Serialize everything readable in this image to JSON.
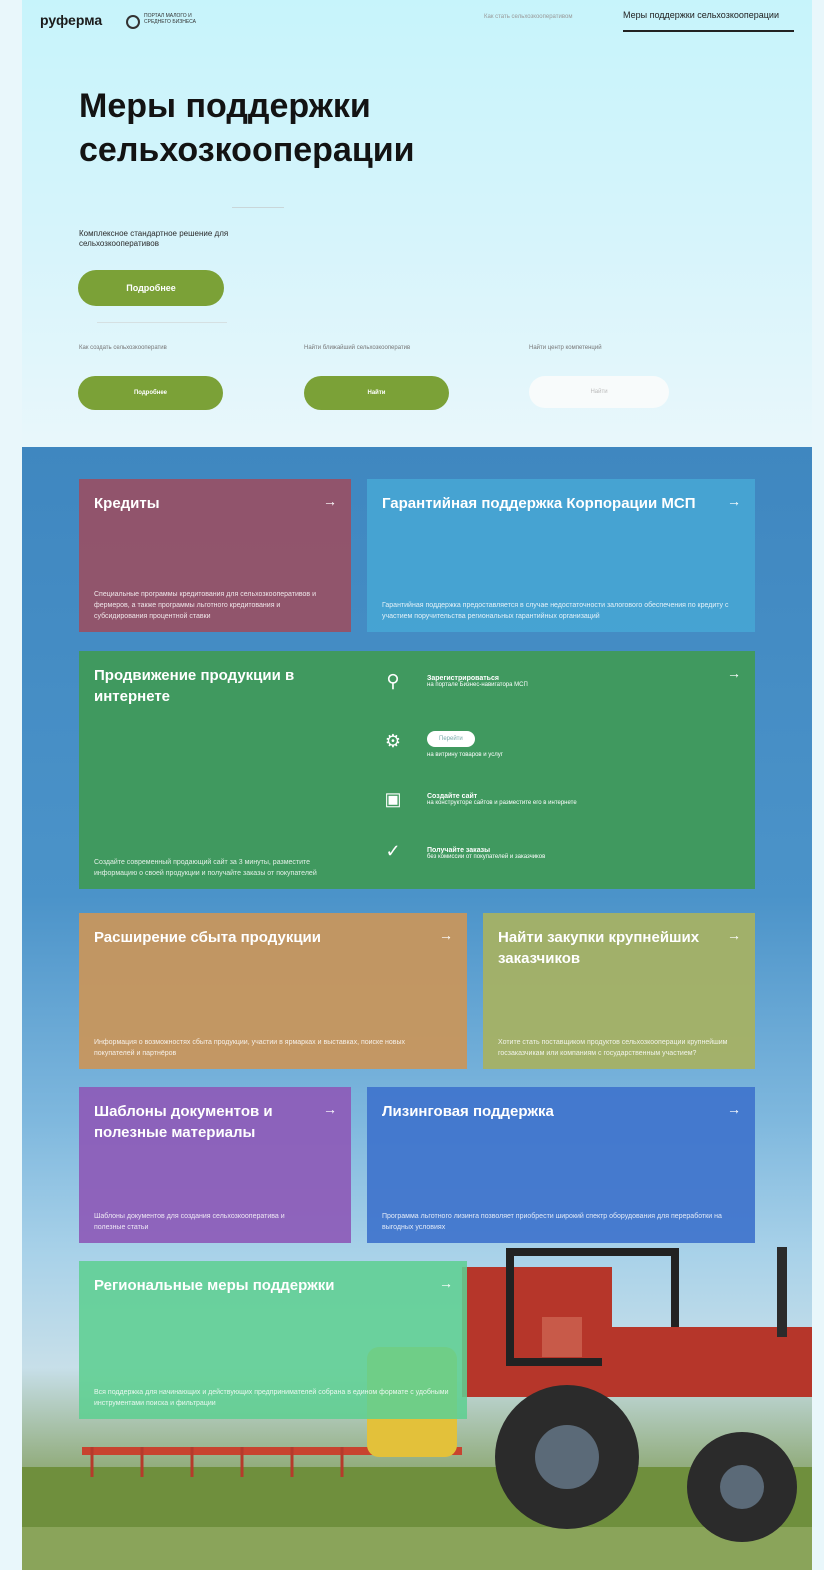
{
  "header": {
    "logo": "руферма",
    "portal": "ПОРТАЛ МАЛОГО И СРЕДНЕГО БИЗНЕСА",
    "nav": [
      "Как стать сельхозкооперативом",
      "Меры поддержки сельхозкооперации"
    ]
  },
  "hero": {
    "title_line1": "Меры поддержки",
    "title_line2": "сельхозкооперации",
    "subtitle": "Комплексное стандартное решение для сельхозкооперативов",
    "more_button": "Подробнее",
    "links": [
      "Как создать сельхозкооператив",
      "Найти ближайший сельхозкооператив",
      "Найти центр компетенций"
    ],
    "buttons": [
      "Подробнее",
      "Найти",
      "Найти"
    ]
  },
  "cards": {
    "credits": {
      "title": "Кредиты",
      "desc": "Специальные программы кредитования для сельхозкооперативов и фермеров, а также программы льготного кредитования и субсидирования процентной ставки"
    },
    "guarantee": {
      "title": "Гарантийная поддержка Корпорации МСП",
      "desc": "Гарантийная поддержка предоставляется в случае недостаточности залогового обеспечения по кредиту с участием поручительства региональных гарантийных организаций"
    },
    "promotion": {
      "title": "Продвижение продукции в интернете",
      "desc": "Создайте современный продающий сайт за 3 минуты, разместите информацию о своей продукции и получайте заказы от покупателей",
      "services": [
        {
          "title": "Зарегистрироваться",
          "text": "на портале Бизнес-навигатора МСП"
        },
        {
          "button": "Перейти",
          "text": "на витрину товаров и услуг"
        },
        {
          "title": "Создайте сайт",
          "text": "на конструкторе сайтов и разместите его в интернете"
        },
        {
          "title": "Получайте заказы",
          "text": "без комиссии от покупателей и заказчиков"
        }
      ]
    },
    "sales": {
      "title": "Расширение сбыта продукции",
      "desc": "Информация о возможностях сбыта продукции, участии в ярмарках и выставках, поиске новых покупателей и партнёров"
    },
    "purchases": {
      "title": "Найти закупки крупнейших заказчиков",
      "desc": "Хотите стать поставщиком продуктов сельхозкооперации крупнейшим госзаказчикам или компаниям с государственным участием?"
    },
    "templates": {
      "title": "Шаблоны документов и полезные материалы",
      "desc": "Шаблоны документов для создания сельхозкооператива и полезные статьи"
    },
    "leasing": {
      "title": "Лизинговая поддержка",
      "desc": "Программа льготного лизинга позволяет приобрести широкий спектр оборудования для переработки на выгодных условиях"
    },
    "regional": {
      "title": "Региональные меры поддержки",
      "desc": "Вся поддержка для начинающих и действующих предпринимателей собрана в едином формате с удобными инструментами поиска и фильтрации"
    }
  },
  "icons": [
    "arrow-right-icon",
    "user-location-icon",
    "search-icon",
    "website-icon",
    "checkmark-icon",
    "portal-logo-icon"
  ],
  "colors": {
    "accent_green": "#7ba137",
    "credits": "#9a4f63",
    "guarantee": "#47a5d4",
    "promotion": "#3f9a57",
    "sales": "#c9965a",
    "purchases": "#a7b262",
    "templates": "#8d5bb8",
    "leasing": "#3f74cc",
    "regional": "#5fcf92"
  }
}
